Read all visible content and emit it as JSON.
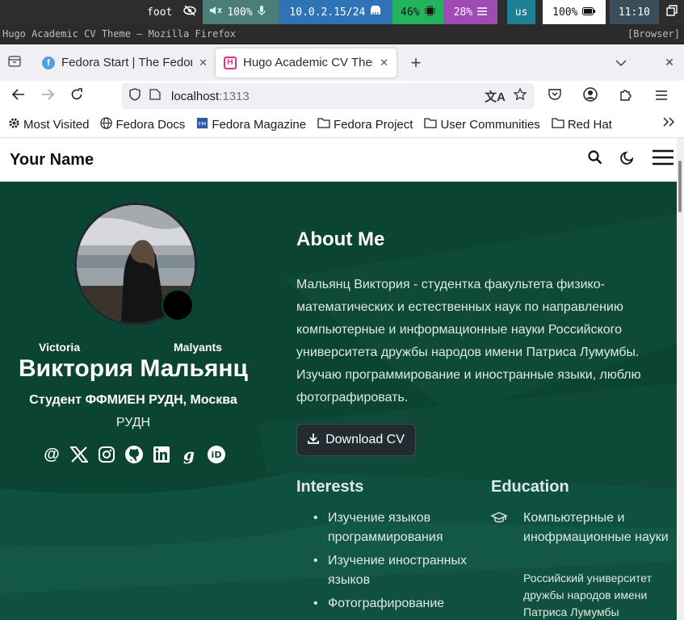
{
  "statusbar": {
    "app": "foot",
    "volume": "100%",
    "network": "10.0.2.15/24",
    "cpu": "46%",
    "memory": "28%",
    "keyboard": "us",
    "battery": "100%",
    "clock": "11:10"
  },
  "window": {
    "title": "Hugo Academic CV Theme — Mozilla Firefox",
    "mode": "[Browser]"
  },
  "tabs": [
    {
      "label": "Fedora Start | The Fedora",
      "favicon": "fedora"
    },
    {
      "label": "Hugo Academic CV Theme",
      "favicon": "H"
    }
  ],
  "url": {
    "host": "localhost",
    "port": ":1313"
  },
  "bookmarks": [
    "Most Visited",
    "Fedora Docs",
    "Fedora Magazine",
    "Fedora Project",
    "User Communities",
    "Red Hat"
  ],
  "site": {
    "brand": "Your Name"
  },
  "profile": {
    "first": "Victoria",
    "last": "Malyants",
    "fullname": "Виктория Мальянц",
    "role": "Студент ФФМИЕН РУДН, Москва",
    "org": "РУДН",
    "socials": [
      "email-icon",
      "x-icon",
      "instagram-icon",
      "github-icon",
      "linkedin-icon",
      "google-scholar-icon",
      "orcid-icon"
    ]
  },
  "about": {
    "heading": "About Me",
    "bio": "Мальянц Виктория - студентка факультета физико-математических и естественных наук по направлению компьютерные и информационные науки Российского университета дружбы народов имени Патриса Лумумбы. Изучаю программирование и иностранные языки, люблю фотографировать.",
    "download": "Download CV"
  },
  "interests": {
    "heading": "Interests",
    "items": [
      "Изучение языков программирования",
      "Изучение иностранных языков",
      "Фотографирование"
    ]
  },
  "education": {
    "heading": "Education",
    "course": "Компьютерные и инофрмационные науки",
    "institution": "Российский университет дружбы народов имени Патриса Лумумбы"
  },
  "colors": {
    "hero": "#0d4634",
    "accent": "#23b35c"
  }
}
